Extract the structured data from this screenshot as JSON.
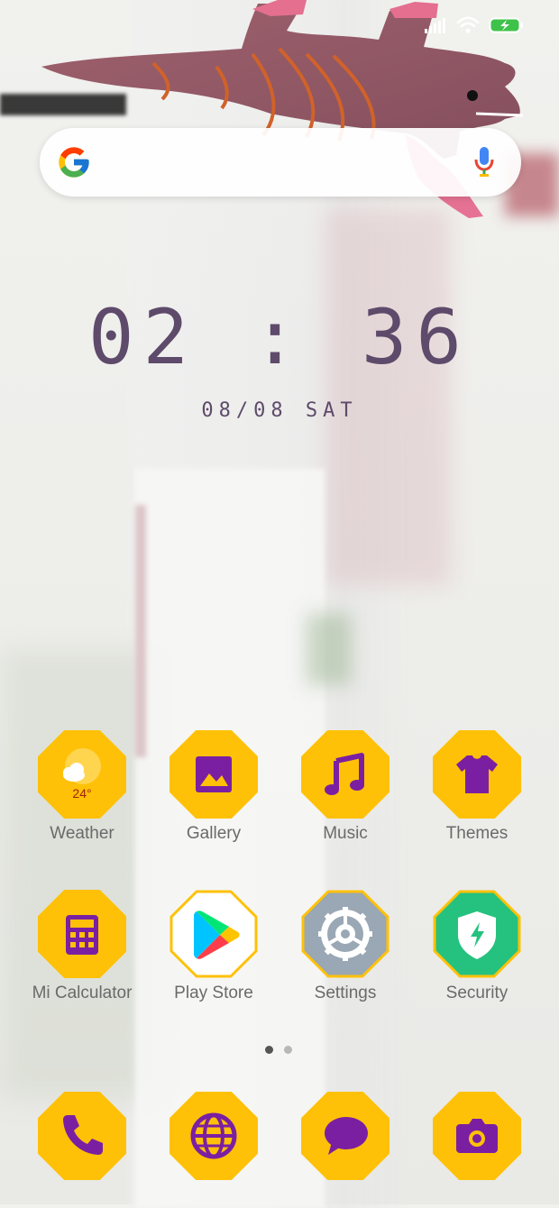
{
  "status": {
    "icons": [
      "signal-icon",
      "wifi-icon",
      "battery-charging-icon"
    ]
  },
  "search": {
    "icons": [
      "google-g-icon",
      "microphone-icon"
    ]
  },
  "clock": {
    "time": "02 : 36",
    "date": "08/08 SAT"
  },
  "apps": [
    {
      "label": "Weather",
      "icon": "weather-icon",
      "temperature": "24°"
    },
    {
      "label": "Gallery",
      "icon": "gallery-icon"
    },
    {
      "label": "Music",
      "icon": "music-icon"
    },
    {
      "label": "Themes",
      "icon": "tshirt-icon"
    },
    {
      "label": "Mi Calculator",
      "icon": "calculator-icon"
    },
    {
      "label": "Play Store",
      "icon": "play-store-icon"
    },
    {
      "label": "Settings",
      "icon": "gear-icon"
    },
    {
      "label": "Security",
      "icon": "shield-icon"
    }
  ],
  "dock": [
    {
      "icon": "phone-icon"
    },
    {
      "icon": "globe-icon"
    },
    {
      "icon": "message-icon"
    },
    {
      "icon": "camera-icon"
    }
  ],
  "page_indicator": {
    "count": 2,
    "active_index": 0
  },
  "colors": {
    "icon_yellow": "#FFC107",
    "icon_purple": "#7B1FA2",
    "clock_text": "#5E4A6A"
  }
}
